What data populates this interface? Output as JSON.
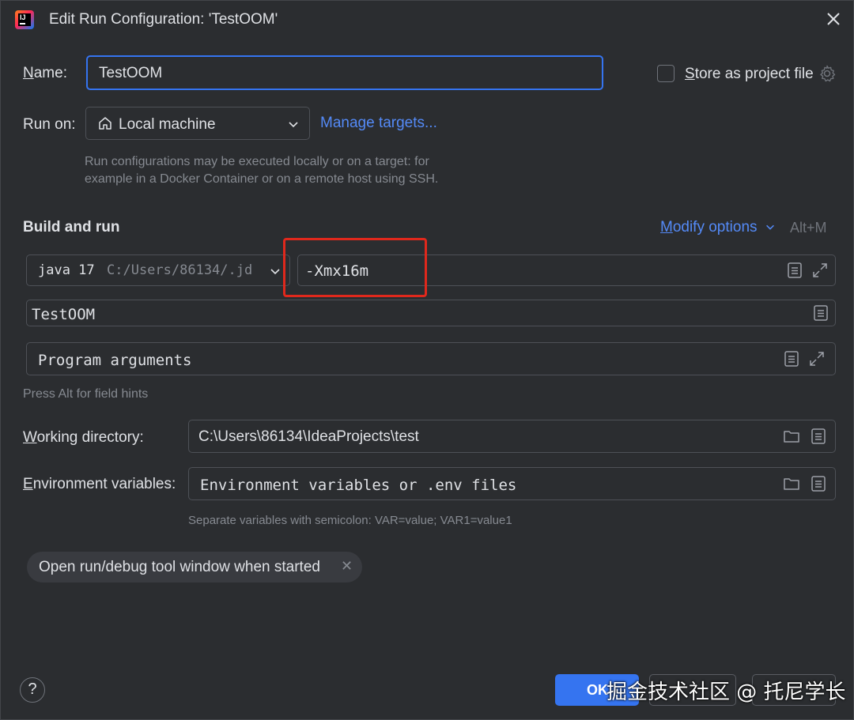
{
  "window": {
    "title": "Edit Run Configuration: 'TestOOM'"
  },
  "name_row": {
    "label_first": "N",
    "label_rest": "ame:",
    "value": "TestOOM",
    "store_label_first": "S",
    "store_label_rest": "tore as project file",
    "store_checked": false
  },
  "run_on": {
    "label": "Run on:",
    "selected": "Local machine",
    "manage_link": "Manage targets...",
    "hint_line1": "Run configurations may be executed locally or on a target: for",
    "hint_line2": "example in a Docker Container or on a remote host using SSH."
  },
  "build_run": {
    "heading": "Build and run",
    "modify_first": "M",
    "modify_rest": "odify options",
    "shortcut": "Alt+M",
    "jdk_name": "java 17",
    "jdk_path": "C:/Users/86134/.jd",
    "vm_options": "-Xmx16m",
    "main_class": "TestOOM",
    "program_args_placeholder": "Program arguments",
    "field_hint": "Press Alt for field hints"
  },
  "working_dir": {
    "label_first": "W",
    "label_rest": "orking directory:",
    "value": "C:\\Users\\86134\\IdeaProjects\\test"
  },
  "env_vars": {
    "label_first": "E",
    "label_rest": "nvironment variables:",
    "placeholder": "Environment variables or .env files",
    "hint": "Separate variables with semicolon: VAR=value; VAR1=value1"
  },
  "chip": {
    "label": "Open run/debug tool window when started"
  },
  "footer": {
    "help": "?",
    "ok": "OK",
    "watermark": "掘金技术社区 @ 托尼学长"
  },
  "colors": {
    "background": "#2b2d30",
    "accent": "#3574f0",
    "link": "#548af7",
    "highlight_box": "#e0281c"
  }
}
